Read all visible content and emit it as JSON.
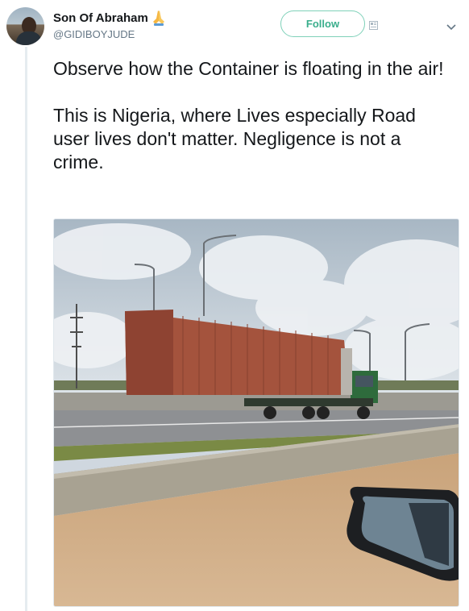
{
  "tweet": {
    "author": {
      "display_name": "Son Of Abraham",
      "emoji_icon": "folded-hands-emoji",
      "handle": "@GIDIBOYJUDE",
      "avatar_icon": "profile-photo"
    },
    "follow_label": "Follow",
    "follow_icon": "follow-person-icon",
    "menu_icon": "chevron-down-icon",
    "paragraphs": [
      "Observe how the Container is floating in the air!",
      "This is Nigeria, where Lives especially Road user lives don't matter. Negligence is not a crime."
    ],
    "media": {
      "kind": "photo",
      "subject": "truck-with-shipping-container-on-highway"
    }
  },
  "colors": {
    "accent": "#3aae8c",
    "follow_border": "#7fd1b9",
    "secondary_text": "#657786",
    "thread_line": "#e6ecf0"
  }
}
